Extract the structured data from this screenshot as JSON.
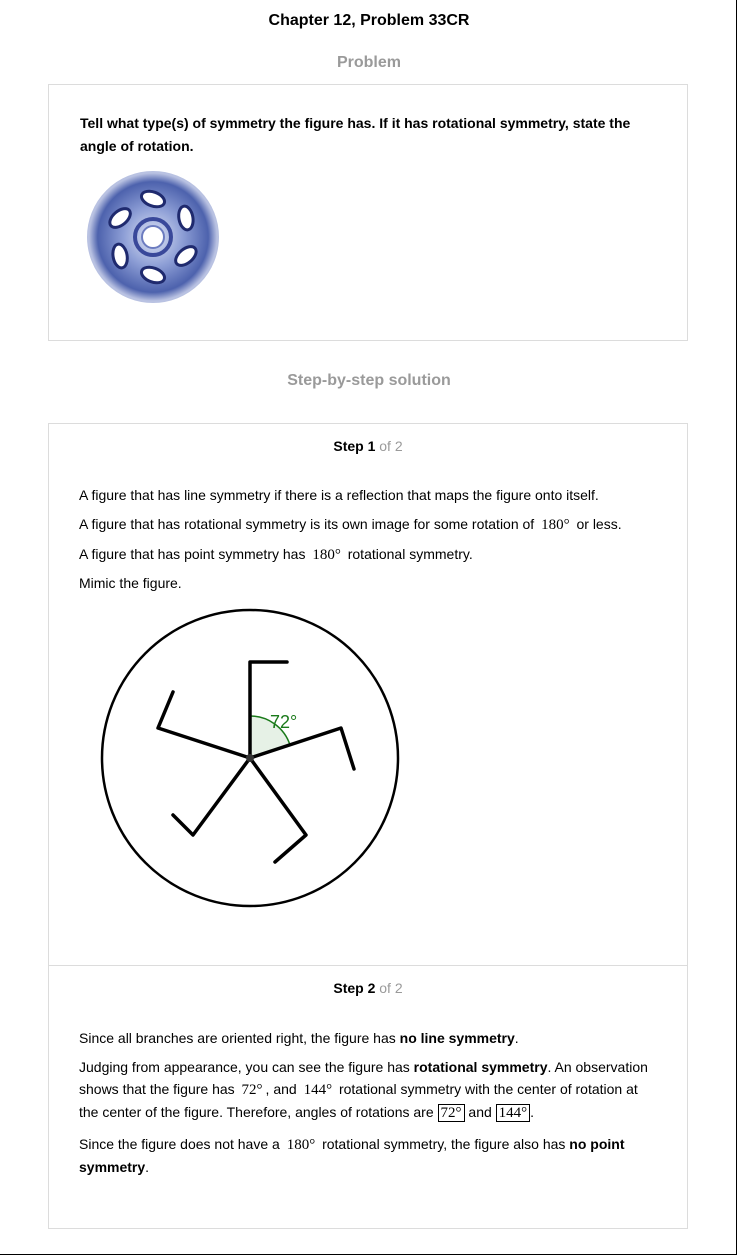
{
  "header": {
    "title": "Chapter 12, Problem 33CR"
  },
  "problem": {
    "heading": "Problem",
    "text": "Tell what type(s) of symmetry the figure has. If it has rotational symmetry, state the angle of rotation."
  },
  "solution": {
    "heading": "Step-by-step solution"
  },
  "step1": {
    "label": "Step 1",
    "of": "of 2",
    "p1": "A figure that has line symmetry if there is a reflection that maps the figure onto itself.",
    "p2_a": "A figure that has rotational symmetry is its own image for some rotation of",
    "p2_math": "180°",
    "p2_b": "or less.",
    "p3_a": "A figure that has point symmetry has",
    "p3_math": "180°",
    "p3_b": "rotational symmetry.",
    "p4": "Mimic the figure.",
    "angle_label": "72°"
  },
  "step2": {
    "label": "Step 2",
    "of": "of 2",
    "p1_a": "Since all branches are oriented right, the figure has ",
    "p1_bold": "no line symmetry",
    "p1_b": ".",
    "p2_a": "Judging from appearance, you can see the figure has ",
    "p2_bold": "rotational symmetry",
    "p2_b": ". An observation shows that the figure has",
    "p2_m1": "72°",
    "p2_c": ", and",
    "p2_m2": "144°",
    "p2_d": "rotational symmetry with the center of rotation at the center of the figure. Therefore, angles of rotations are",
    "p2_box1": "72°",
    "p2_e": "and",
    "p2_box2": "144°",
    "p2_f": ".",
    "p3_a": "Since the figure does not have a",
    "p3_m": "180°",
    "p3_b": "rotational symmetry, the figure also has ",
    "p3_bold": "no point symmetry",
    "p3_c": "."
  },
  "colors": {
    "heading_gray": "#9a9a9a",
    "border": "#dcdcdc",
    "angle_green": "#1a7a1a",
    "wheel_blue": "#5a6fb4"
  }
}
